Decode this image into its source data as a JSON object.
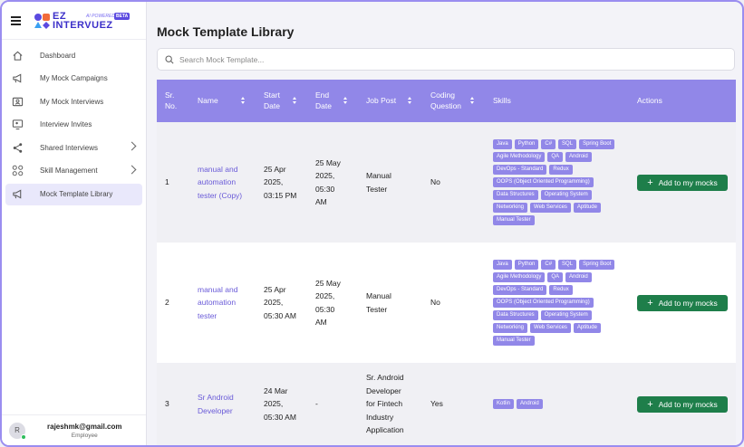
{
  "app": {
    "logo_top": "EZ",
    "logo_bottom": "INTERVUEZ",
    "powered": "AI POWERED",
    "beta": "BETA"
  },
  "sidebar": {
    "items": [
      {
        "label": "Dashboard",
        "icon": "home-icon",
        "active": false,
        "chevron": false
      },
      {
        "label": "My Mock Campaigns",
        "icon": "megaphone-icon",
        "active": false,
        "chevron": false
      },
      {
        "label": "My Mock Interviews",
        "icon": "user-card-icon",
        "active": false,
        "chevron": false
      },
      {
        "label": "Interview Invites",
        "icon": "monitor-user-icon",
        "active": false,
        "chevron": false
      },
      {
        "label": "Shared Interviews",
        "icon": "share-icon",
        "active": false,
        "chevron": true
      },
      {
        "label": "Skill Management",
        "icon": "skills-icon",
        "active": false,
        "chevron": true
      },
      {
        "label": "Mock Template Library",
        "icon": "megaphone-icon",
        "active": true,
        "chevron": false
      }
    ],
    "user": {
      "initial": "R",
      "email": "rajeshmk@gmail.com",
      "role": "Employee"
    }
  },
  "main": {
    "title": "Mock Template Library",
    "search_placeholder": "Search Mock Template...",
    "columns": {
      "sr": [
        "Sr.",
        "No."
      ],
      "name": "Name",
      "start": [
        "Start",
        "Date"
      ],
      "end": [
        "End",
        "Date"
      ],
      "job": "Job Post",
      "coding": [
        "Coding",
        "Question"
      ],
      "skills": "Skills",
      "actions": "Actions"
    },
    "add_label": "Add to my mocks",
    "rows": [
      {
        "sr": "1",
        "name": [
          "manual and",
          "automation",
          "tester (Copy)"
        ],
        "start": [
          "25 Apr",
          "2025,",
          "03:15 PM"
        ],
        "end": [
          "25 May",
          "2025,",
          "05:30",
          "AM"
        ],
        "job": [
          "Manual",
          "Tester"
        ],
        "coding": "No",
        "skills": [
          "Java",
          "Python",
          "C#",
          "SQL",
          "Spring Boot",
          "Agile Methodology",
          "QA",
          "Android",
          "DevOps - Standard",
          "Redux",
          "OOPS (Object Oriented Programming)",
          "Data Structures",
          "Operating System",
          "Networking",
          "Web Services",
          "Aptitude",
          "Manual Tester"
        ]
      },
      {
        "sr": "2",
        "name": [
          "manual and",
          "automation",
          "tester"
        ],
        "start": [
          "25 Apr",
          "2025,",
          "05:30 AM"
        ],
        "end": [
          "25 May",
          "2025,",
          "05:30",
          "AM"
        ],
        "job": [
          "Manual",
          "Tester"
        ],
        "coding": "No",
        "skills": [
          "Java",
          "Python",
          "C#",
          "SQL",
          "Spring Boot",
          "Agile Methodology",
          "QA",
          "Android",
          "DevOps - Standard",
          "Redux",
          "OOPS (Object Oriented Programming)",
          "Data Structures",
          "Operating System",
          "Networking",
          "Web Services",
          "Aptitude",
          "Manual Tester"
        ]
      },
      {
        "sr": "3",
        "name": [
          "Sr Android",
          "Developer"
        ],
        "start": [
          "24 Mar",
          "2025,",
          "05:30 AM"
        ],
        "end": [
          "-"
        ],
        "job": [
          "Sr. Android",
          "Developer",
          "for Fintech",
          "Industry",
          "Application"
        ],
        "coding": "Yes",
        "skills": [
          "Kotlin",
          "Android"
        ]
      }
    ]
  }
}
